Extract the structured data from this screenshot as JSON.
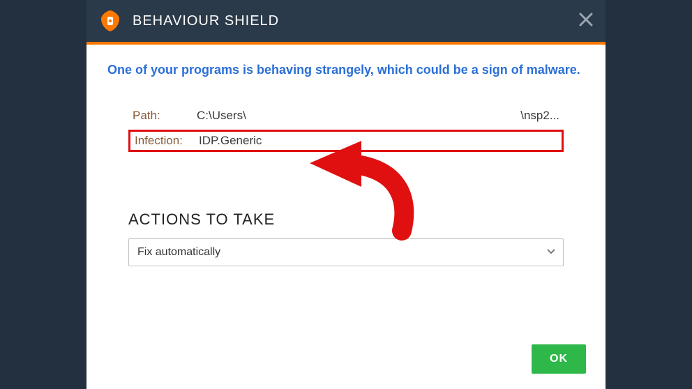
{
  "header": {
    "title": "BEHAVIOUR SHIELD"
  },
  "warning": "One of your programs is behaving strangely, which could be a sign of malware.",
  "details": {
    "path_label": "Path:",
    "path_value_left": "C:\\Users\\",
    "path_value_right": "\\nsp2...",
    "infection_label": "Infection:",
    "infection_value": "IDP.Generic"
  },
  "actions": {
    "title": "ACTIONS TO TAKE",
    "selected": "Fix automatically"
  },
  "footer": {
    "ok_label": "OK"
  },
  "colors": {
    "accent": "#ff7800",
    "header_bg": "#2a3a4a",
    "ok_bg": "#2eb84a",
    "highlight_border": "#e01010",
    "warning_text": "#2b6fd8"
  }
}
